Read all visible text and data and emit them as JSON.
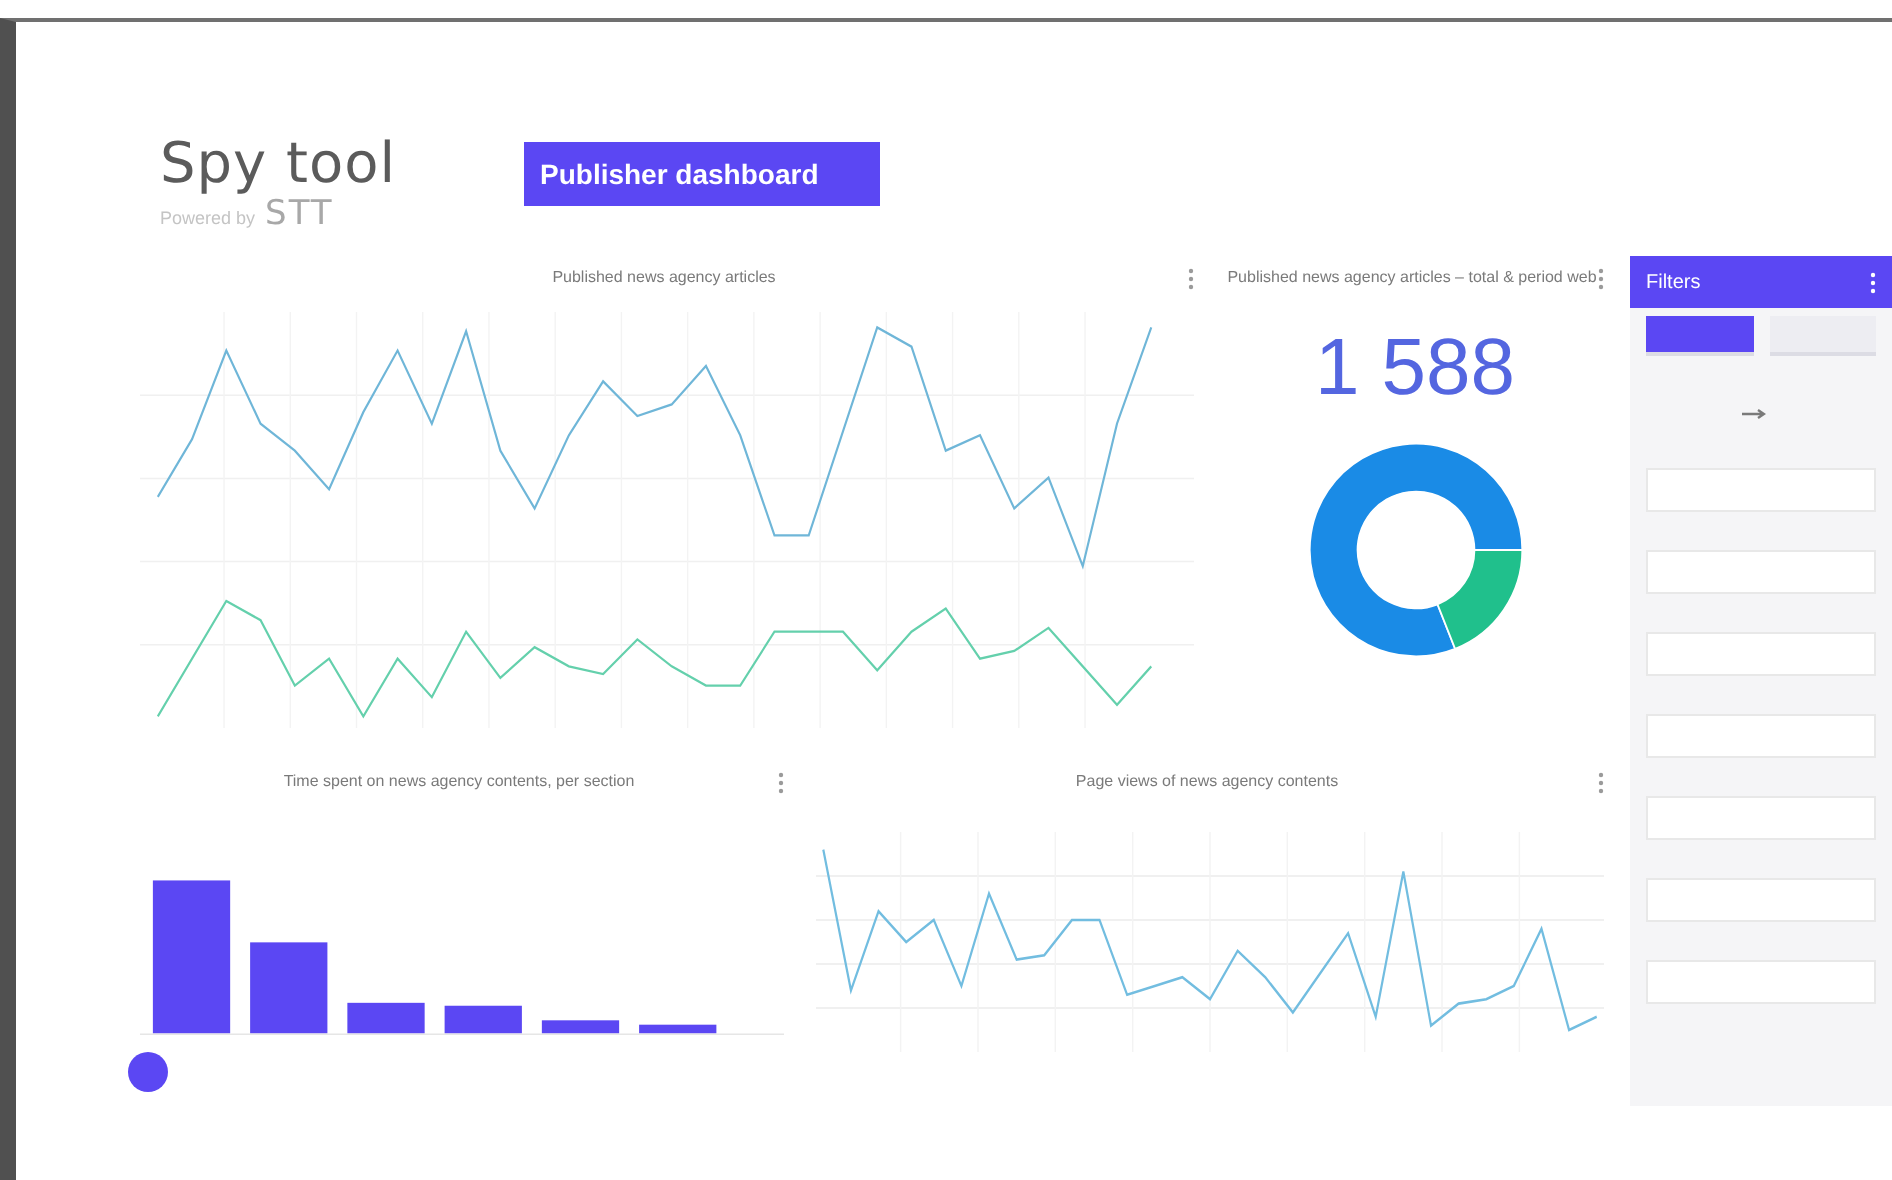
{
  "logo": {
    "title": "Spy tool",
    "tagline": "Powered by",
    "brand": "STT"
  },
  "dashboard_button": {
    "label": "Publisher dashboard"
  },
  "cards": [
    {
      "kind": "line_double",
      "title": "Published news agency articles"
    },
    {
      "kind": "kpi_donut",
      "title": "Published news agency articles – total & period web",
      "value": "1 588"
    },
    {
      "kind": "bar",
      "title": "Time spent on news agency contents, per section"
    },
    {
      "kind": "line_single",
      "title": "Page views of news agency contents"
    }
  ],
  "filters": {
    "title": "Filters",
    "tabs": [
      {
        "selected": true
      },
      {
        "selected": false
      }
    ],
    "fields": [
      {
        "kind": "date_range"
      },
      {
        "kind": "select"
      },
      {
        "kind": "select"
      },
      {
        "kind": "select"
      },
      {
        "kind": "select"
      },
      {
        "kind": "select"
      },
      {
        "kind": "select"
      },
      {
        "kind": "select"
      }
    ]
  }
}
